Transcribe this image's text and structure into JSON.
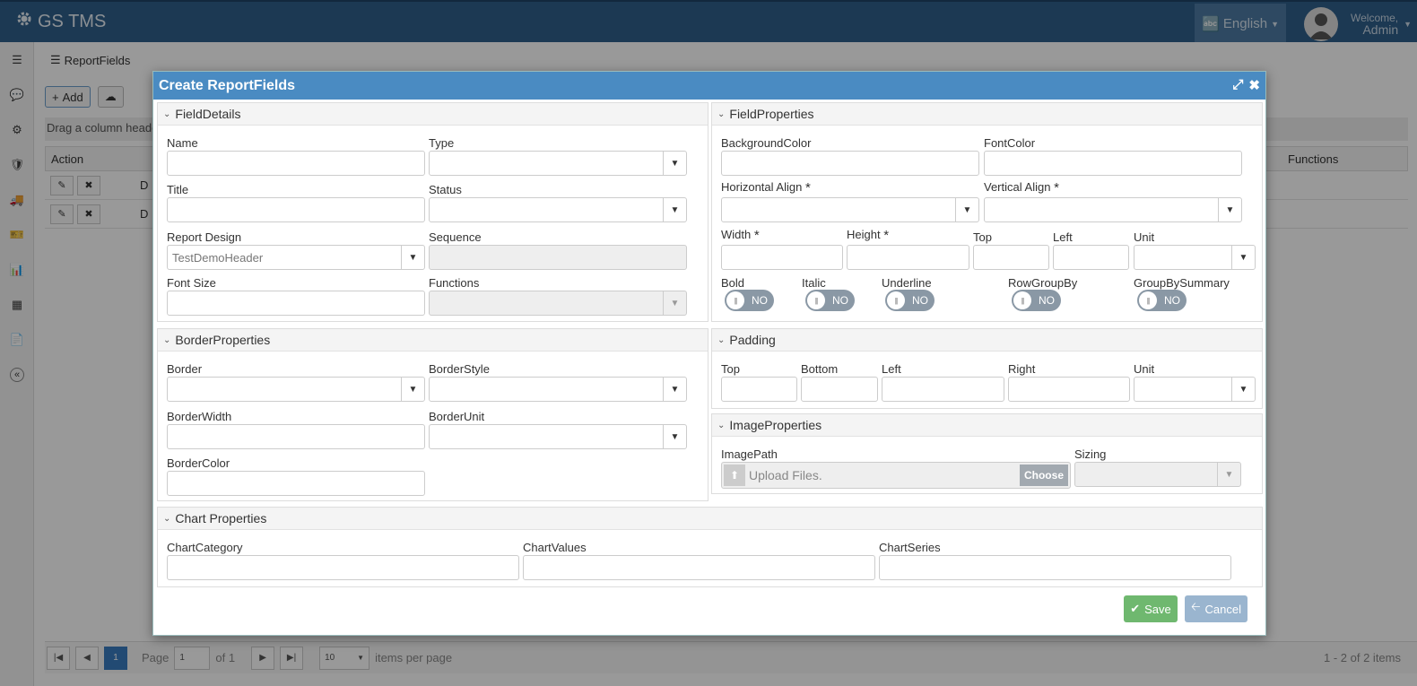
{
  "app": {
    "title": "GS TMS",
    "language": "English",
    "welcome": "Welcome,",
    "user": "Admin"
  },
  "page": {
    "breadcrumb": "ReportFields",
    "add_label": "Add",
    "group_hint": "Drag a column header"
  },
  "grid": {
    "columns": [
      "Action",
      "Functions"
    ],
    "rows": [
      {
        "first_letter": "D"
      },
      {
        "first_letter": "D"
      }
    ]
  },
  "pager": {
    "page_label": "Page",
    "page_value": "1",
    "of_label": "of 1",
    "current_page": "1",
    "page_size": "10",
    "items_per_page": "items per page",
    "summary": "1 - 2 of 2 items"
  },
  "modal": {
    "title": "Create ReportFields",
    "field_details": {
      "heading": "FieldDetails",
      "name_label": "Name",
      "type_label": "Type",
      "title_label": "Title",
      "status_label": "Status",
      "report_design_label": "Report Design",
      "report_design_value": "TestDemoHeader",
      "sequence_label": "Sequence",
      "font_size_label": "Font Size",
      "functions_label": "Functions"
    },
    "field_properties": {
      "heading": "FieldProperties",
      "background_color_label": "BackgroundColor",
      "font_color_label": "FontColor",
      "horizontal_align_label": "Horizontal Align",
      "vertical_align_label": "Vertical Align",
      "width_label": "Width",
      "height_label": "Height",
      "top_label": "Top",
      "left_label": "Left",
      "unit_label": "Unit",
      "bold_label": "Bold",
      "italic_label": "Italic",
      "underline_label": "Underline",
      "rowgroupby_label": "RowGroupBy",
      "groupbysummary_label": "GroupBySummary",
      "toggle_value": "NO",
      "required_mark": "*"
    },
    "border_properties": {
      "heading": "BorderProperties",
      "border_label": "Border",
      "border_style_label": "BorderStyle",
      "border_width_label": "BorderWidth",
      "border_unit_label": "BorderUnit",
      "border_color_label": "BorderColor"
    },
    "padding": {
      "heading": "Padding",
      "top_label": "Top",
      "bottom_label": "Bottom",
      "left_label": "Left",
      "right_label": "Right",
      "unit_label": "Unit"
    },
    "image_properties": {
      "heading": "ImageProperties",
      "image_path_label": "ImagePath",
      "upload_placeholder": "Upload Files.",
      "choose_label": "Choose",
      "sizing_label": "Sizing"
    },
    "chart_properties": {
      "heading": "Chart Properties",
      "chart_category_label": "ChartCategory",
      "chart_values_label": "ChartValues",
      "chart_series_label": "ChartSeries"
    },
    "save_label": "Save",
    "cancel_label": "Cancel"
  },
  "colors": {
    "topbar": "#2f5f8a",
    "modal_header": "#4a8bc2",
    "save": "#5cb85c",
    "cancel": "#8fb0cf"
  }
}
